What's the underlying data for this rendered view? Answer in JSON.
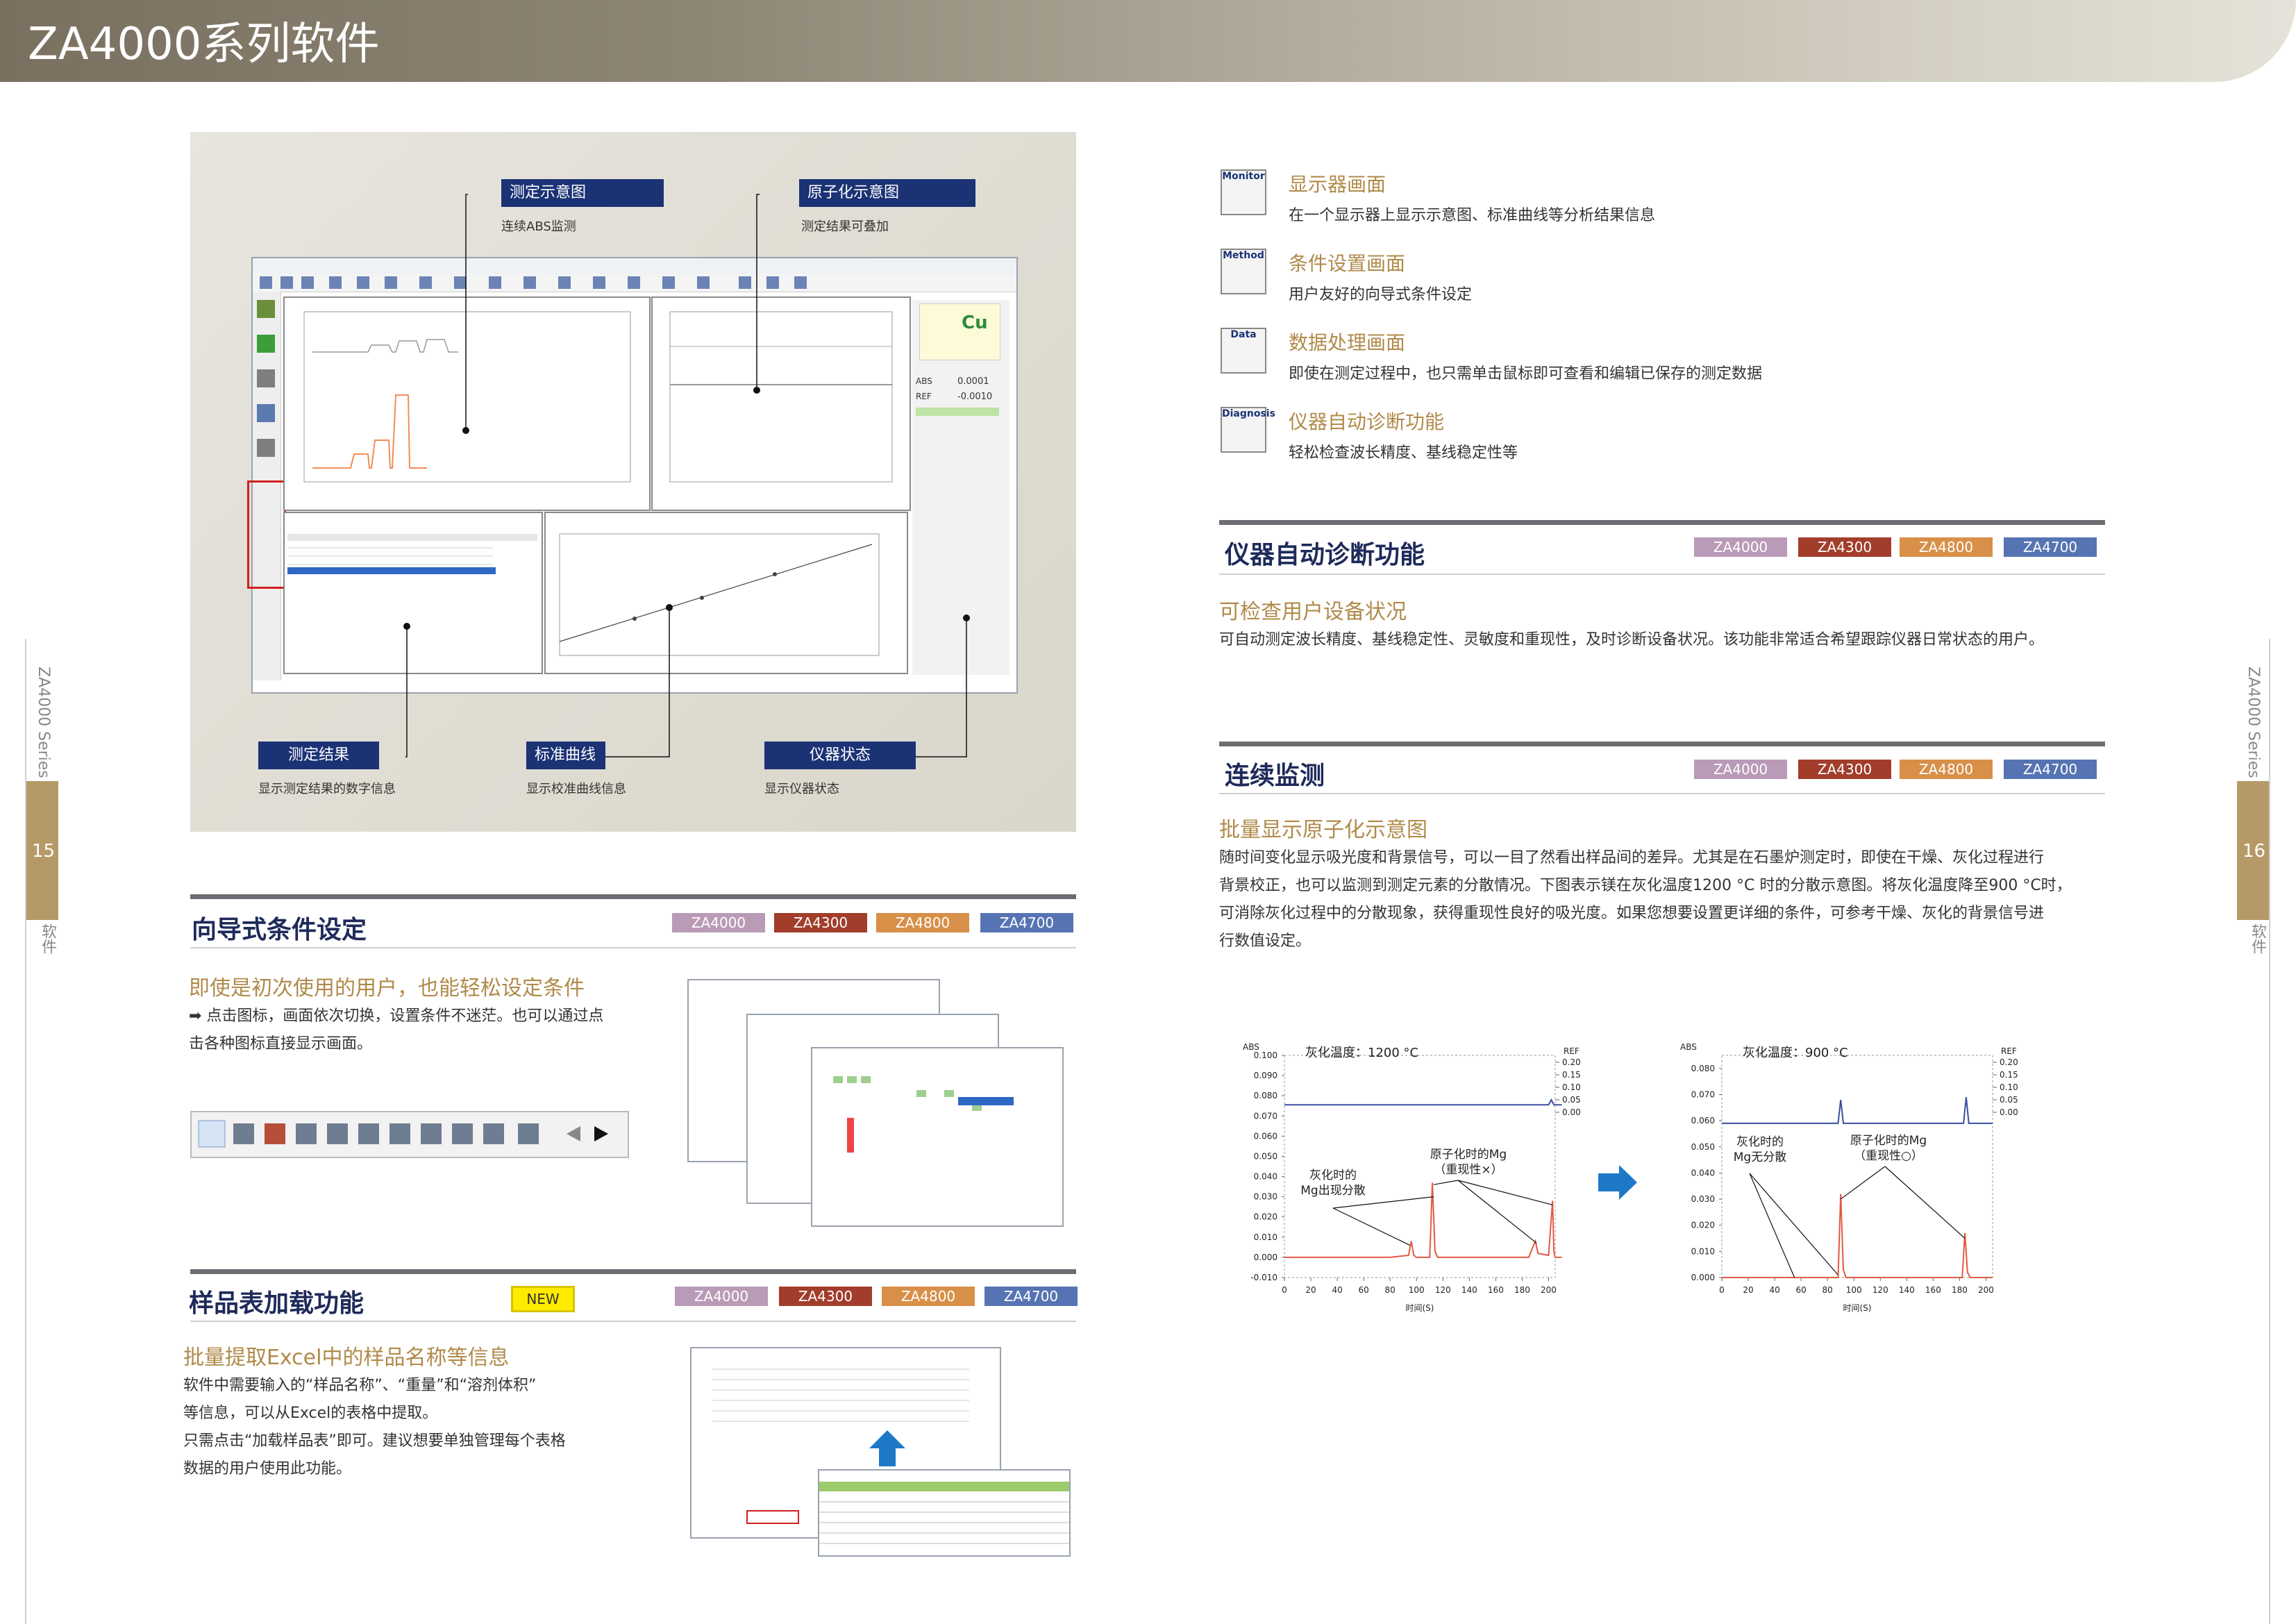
{
  "header": {
    "title": "ZA4000系列软件"
  },
  "side": {
    "left_series": "ZA4000 Series",
    "left_page": "15",
    "left_label": "软件",
    "right_series": "ZA4000 Series",
    "right_page": "16",
    "right_label": "软件"
  },
  "screenshot": {
    "callouts": [
      {
        "label": "测定示意图",
        "desc": "连续ABS监测"
      },
      {
        "label": "原子化示意图",
        "desc": "测定结果可叠加"
      },
      {
        "label": "测定结果",
        "desc": "显示测定结果的数字信息"
      },
      {
        "label": "标准曲线",
        "desc": "显示校准曲线信息"
      },
      {
        "label": "仪器状态",
        "desc": "显示仪器状态"
      }
    ],
    "element": "Cu",
    "abs_label": "ABS",
    "abs_value": "0.0001",
    "ref_label": "REF",
    "ref_value": "-0.0010"
  },
  "features": [
    {
      "icon": "Monitor",
      "title": "显示器画面",
      "desc": "在一个显示器上显示示意图、标准曲线等分析结果信息"
    },
    {
      "icon": "Method",
      "title": "条件设置画面",
      "desc": "用户友好的向导式条件设定"
    },
    {
      "icon": "Data",
      "title": "数据处理画面",
      "desc": "即使在测定过程中，也只需单击鼠标即可查看和编辑已保存的测定数据"
    },
    {
      "icon": "Diagnosis",
      "title": "仪器自动诊断功能",
      "desc": "轻松检查波长精度、基线稳定性等"
    }
  ],
  "models": [
    "ZA4000",
    "ZA4300",
    "ZA4800",
    "ZA4700"
  ],
  "wizard": {
    "title": "向导式条件设定",
    "subhead": "即使是初次使用的用户，也能轻松设定条件",
    "body1": "➡ 点击图标，画面依次切换，设置条件不迷茫。也可以通过点",
    "body2": "击各种图标直接显示画面。"
  },
  "sampletable": {
    "title": "样品表加载功能",
    "new": "NEW",
    "subhead": "批量提取Excel中的样品名称等信息",
    "lines": [
      "软件中需要输入的“样品名称”、“重量”和“溶剂体积”",
      "等信息，可以从Excel的表格中提取。",
      "只需点击“加载样品表”即可。建议想要单独管理每个表格",
      "数据的用户使用此功能。"
    ]
  },
  "diagnosis": {
    "title": "仪器自动诊断功能",
    "subhead": "可检查用户设备状况",
    "body": "可自动测定波长精度、基线稳定性、灵敏度和重现性，及时诊断设备状况。该功能非常适合希望跟踪仪器日常状态的用户。"
  },
  "monitor": {
    "title": "连续监测",
    "subhead": "批量显示原子化示意图",
    "lines": [
      "随时间变化显示吸光度和背景信号，可以一目了然看出样品间的差异。尤其是在石墨炉测定时，即使在干燥、灰化过程进行",
      "背景校正，也可以监测到测定元素的分散情况。下图表示镁在灰化温度1200 °C 时的分散示意图。将灰化温度降至900 °C时，",
      "可消除灰化过程中的分散现象，获得重现性良好的吸光度。如果您想要设置更详细的条件，可参考干燥、灰化的背景信号进",
      "行数值设定。"
    ]
  },
  "chart_data": [
    {
      "type": "line",
      "title": "灰化温度：1200 °C",
      "xlabel": "时间(S)",
      "ylabel": "ABS",
      "y2label": "REF",
      "x_ticks": [
        0,
        20,
        40,
        60,
        80,
        100,
        120,
        140,
        160,
        180,
        200
      ],
      "y_ticks": [
        "-0.010",
        "0.000",
        "0.010",
        "0.020",
        "0.030",
        "0.040",
        "0.050",
        "0.060",
        "0.070",
        "0.080",
        "0.090",
        "0.100"
      ],
      "y2_ticks": [
        "0.20",
        "0.15",
        "0.10",
        "0.05",
        "0.00"
      ],
      "ylim": [
        -0.01,
        0.1
      ],
      "xlim": [
        0,
        205
      ],
      "series": [
        {
          "color": "#e25a42",
          "x": [
            0,
            80,
            94,
            96,
            98,
            100,
            110,
            112,
            114,
            116,
            125,
            185,
            188,
            190,
            192,
            200,
            203,
            204,
            205,
            210
          ],
          "y": [
            0.0,
            0.0,
            0.001,
            0.008,
            0.001,
            0.0,
            0.0,
            0.037,
            0.003,
            0.0,
            0.0,
            0.0,
            0.005,
            0.008,
            0.002,
            0.001,
            0.028,
            0.003,
            0.0,
            0.0
          ]
        },
        {
          "color": "#3a4fa0",
          "x": [
            0,
            200,
            202,
            204,
            206,
            210
          ],
          "y": [
            0.0755,
            0.0755,
            0.078,
            0.0755,
            0.0755,
            0.0755
          ]
        }
      ],
      "annotations": [
        {
          "text": "灰化时的\nMg出现分散"
        },
        {
          "text": "原子化时的Mg\n（重现性×）"
        }
      ]
    },
    {
      "type": "line",
      "title": "灰化温度：900 °C",
      "xlabel": "时间(S)",
      "ylabel": "ABS",
      "y2label": "REF",
      "x_ticks": [
        0,
        20,
        40,
        60,
        80,
        100,
        120,
        140,
        160,
        180,
        200
      ],
      "y_ticks": [
        "0.000",
        "0.010",
        "0.020",
        "0.030",
        "0.040",
        "0.050",
        "0.060",
        "0.070",
        "0.080"
      ],
      "y2_ticks": [
        "0.20",
        "0.15",
        "0.10",
        "0.05",
        "0.00"
      ],
      "ylim": [
        0,
        0.085
      ],
      "xlim": [
        0,
        205
      ],
      "series": [
        {
          "color": "#e25a42",
          "x": [
            0,
            88,
            90,
            92,
            94,
            100,
            182,
            184,
            186,
            188,
            205
          ],
          "y": [
            0.0,
            0.0,
            0.032,
            0.003,
            0.0,
            0.0,
            0.0,
            0.017,
            0.002,
            0.0,
            0.0
          ]
        },
        {
          "color": "#3a4fa0",
          "x": [
            0,
            88,
            90,
            92,
            183,
            185,
            187,
            205
          ],
          "y": [
            0.059,
            0.059,
            0.068,
            0.059,
            0.059,
            0.069,
            0.059,
            0.059
          ]
        }
      ],
      "annotations": [
        {
          "text": "灰化时的\nMg无分散"
        },
        {
          "text": "原子化时的Mg\n（重现性○）"
        }
      ]
    }
  ]
}
